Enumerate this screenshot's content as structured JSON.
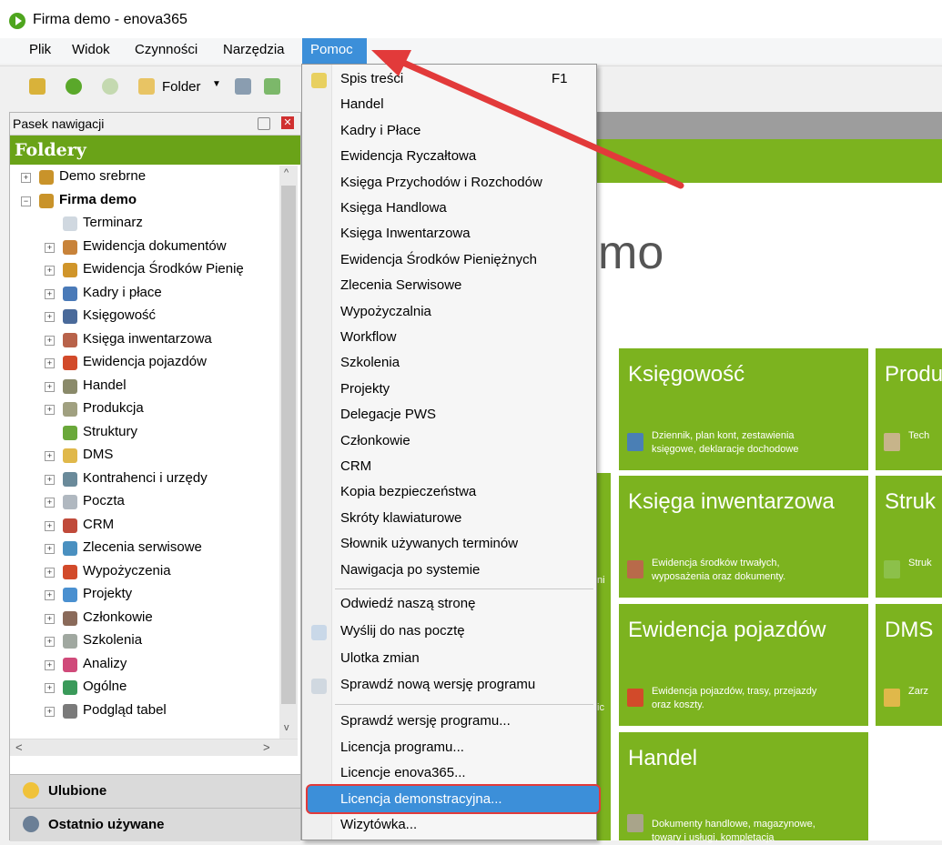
{
  "window": {
    "title": "Firma demo - enova365"
  },
  "menubar": {
    "items": [
      "Plik",
      "Widok",
      "Czynności",
      "Narzędzia"
    ],
    "active": "Pomoc"
  },
  "toolbar": {
    "folder_label": "Folder"
  },
  "nav": {
    "header": "Pasek nawigacji",
    "folders_title": "Foldery",
    "tree": [
      {
        "label": "Demo srebrne",
        "bold": false
      },
      {
        "label": "Firma demo",
        "bold": true
      },
      {
        "label": "Terminarz"
      },
      {
        "label": "Ewidencja dokumentów"
      },
      {
        "label": "Ewidencja Środków Pienię"
      },
      {
        "label": "Kadry i płace"
      },
      {
        "label": "Księgowość"
      },
      {
        "label": "Księga inwentarzowa"
      },
      {
        "label": "Ewidencja pojazdów"
      },
      {
        "label": "Handel"
      },
      {
        "label": "Produkcja"
      },
      {
        "label": "Struktury"
      },
      {
        "label": "DMS"
      },
      {
        "label": "Kontrahenci i urzędy"
      },
      {
        "label": "Poczta"
      },
      {
        "label": "CRM"
      },
      {
        "label": "Zlecenia serwisowe"
      },
      {
        "label": "Wypożyczenia"
      },
      {
        "label": "Projekty"
      },
      {
        "label": "Członkowie"
      },
      {
        "label": "Szkolenia"
      },
      {
        "label": "Analizy"
      },
      {
        "label": "Ogólne"
      },
      {
        "label": "Podgląd tabel"
      }
    ],
    "favorites": "Ulubione",
    "recent": "Ostatnio używane"
  },
  "content": {
    "title_partial": "mo",
    "tiles": [
      {
        "title": "Księgowość",
        "desc1": "Dziennik, plan kont, zestawienia",
        "desc2": "księgowe, deklaracje dochodowe"
      },
      {
        "title": "Produ",
        "desc1": "Tech",
        "desc2": ""
      },
      {
        "title": "Księga inwentarzowa",
        "desc1": "Ewidencja środków trwałych,",
        "desc2": "wyposażenia oraz dokumenty."
      },
      {
        "title": "Struk",
        "desc1": "Struk",
        "desc2": ""
      },
      {
        "title": "Ewidencja pojazdów",
        "desc1": "Ewidencja pojazdów, trasy, przejazdy",
        "desc2": "oraz koszty."
      },
      {
        "title": "DMS",
        "desc1": "Zarz",
        "desc2": ""
      },
      {
        "title": "Handel",
        "desc1": "Dokumenty handlowe, magazynowe,",
        "desc2": "towary i usługi, kompletacja"
      }
    ],
    "left_frag1": "ni",
    "left_frag2": "ic"
  },
  "help_menu": {
    "group1": [
      {
        "label": "Spis treści",
        "shortcut": "F1"
      },
      {
        "label": "Handel"
      },
      {
        "label": "Kadry i Płace"
      },
      {
        "label": "Ewidencja Ryczałtowa"
      },
      {
        "label": "Księga Przychodów i Rozchodów"
      },
      {
        "label": "Księga Handlowa"
      },
      {
        "label": "Księga Inwentarzowa"
      },
      {
        "label": "Ewidencja Środków Pieniężnych"
      },
      {
        "label": "Zlecenia Serwisowe"
      },
      {
        "label": "Wypożyczalnia"
      },
      {
        "label": "Workflow"
      },
      {
        "label": "Szkolenia"
      },
      {
        "label": "Projekty"
      },
      {
        "label": "Delegacje PWS"
      },
      {
        "label": "Członkowie"
      },
      {
        "label": "CRM"
      },
      {
        "label": "Kopia bezpieczeństwa"
      },
      {
        "label": "Skróty klawiaturowe"
      },
      {
        "label": "Słownik używanych terminów"
      },
      {
        "label": "Nawigacja po systemie"
      }
    ],
    "group2": [
      {
        "label": "Odwiedź naszą stronę"
      },
      {
        "label": "Wyślij do nas pocztę"
      },
      {
        "label": "Ulotka zmian"
      },
      {
        "label": "Sprawdź nową wersję programu"
      }
    ],
    "group3": [
      {
        "label": "Sprawdź wersję programu..."
      },
      {
        "label": "Licencja programu..."
      },
      {
        "label": "Licencje enova365..."
      },
      {
        "label": "Licencja demonstracyjna..."
      },
      {
        "label": "Wizytówka..."
      }
    ]
  },
  "colors": {
    "accent_green": "#7cb31f",
    "menu_highlight": "#3c8fd9",
    "annotation_red": "#e23a3a"
  }
}
